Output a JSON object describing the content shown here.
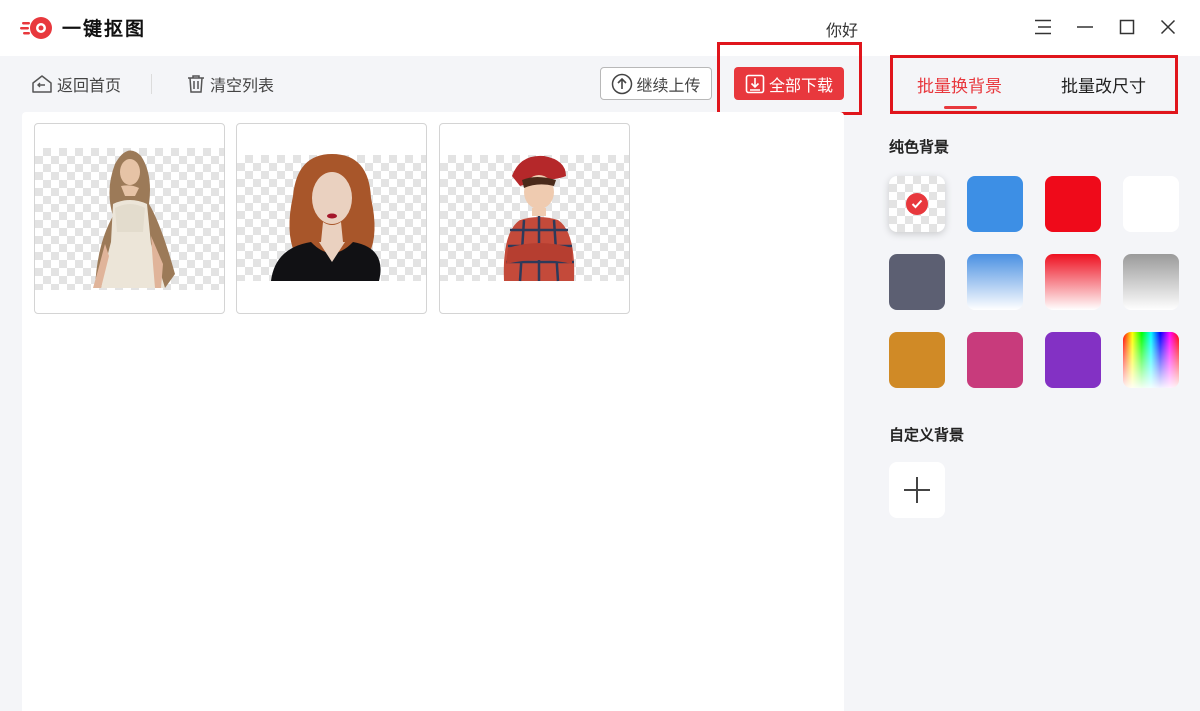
{
  "app": {
    "title": "一键抠图",
    "greeting": "你好"
  },
  "toolbar": {
    "home_label": "返回首页",
    "clear_label": "清空列表",
    "upload_label": "继续上传",
    "download_all_label": "全部下载"
  },
  "images": [
    {
      "subject": "woman-long-hair-white-top"
    },
    {
      "subject": "woman-red-curly-hair-black-top"
    },
    {
      "subject": "boy-red-cap-plaid-shirt"
    }
  ],
  "sidebar": {
    "tabs": [
      {
        "label": "批量换背景",
        "active": true
      },
      {
        "label": "批量改尺寸",
        "active": false
      }
    ],
    "solid_bg_title": "纯色背景",
    "custom_bg_title": "自定义背景",
    "swatches": [
      {
        "name": "transparent",
        "selected": true
      },
      {
        "name": "blue",
        "color": "#3d8fe5"
      },
      {
        "name": "red",
        "color": "#ef0a1a"
      },
      {
        "name": "white",
        "color": "#ffffff"
      },
      {
        "name": "slate",
        "color": "#5c5f72"
      },
      {
        "name": "blue-gradient",
        "from": "#4a90e2",
        "to": "#ffffff"
      },
      {
        "name": "red-gradient",
        "from": "#ee1020",
        "to": "#ffffff"
      },
      {
        "name": "gray-gradient",
        "from": "#9a9a9a",
        "to": "#ffffff"
      },
      {
        "name": "orange",
        "color": "#d08a26"
      },
      {
        "name": "pink",
        "color": "#c83b7c"
      },
      {
        "name": "purple",
        "color": "#8331c4"
      },
      {
        "name": "rainbow"
      }
    ]
  },
  "colors": {
    "accent": "#e8383d",
    "highlight_box": "#e0151c"
  }
}
